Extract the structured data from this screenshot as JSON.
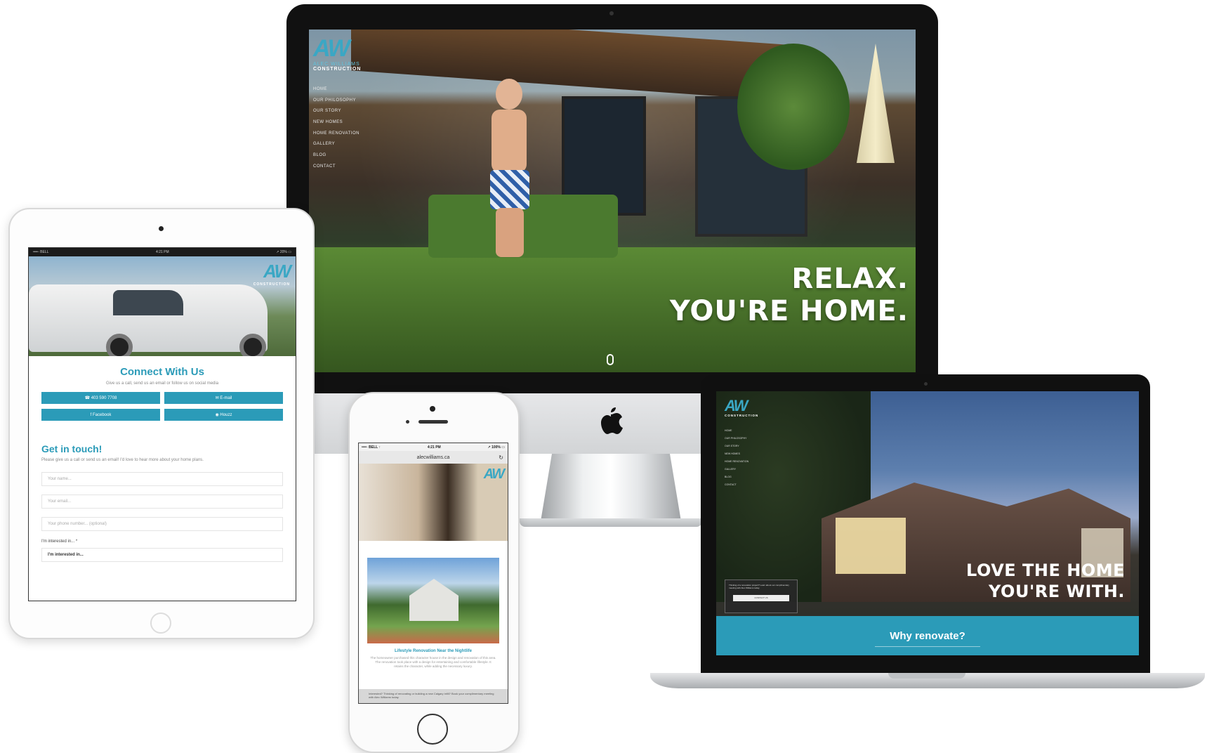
{
  "brand": {
    "logo_mark": "AW",
    "name_line1": "ALEC WILLIAMS",
    "name_line2": "CONSTRUCTION"
  },
  "desktop": {
    "nav": [
      "HOME",
      "OUR PHILOSOPHY",
      "OUR STORY",
      "NEW HOMES",
      "HOME RENOVATION",
      "GALLERY",
      "BLOG",
      "CONTACT"
    ],
    "headline_line1": "RELAX.",
    "headline_line2": "YOU'RE HOME."
  },
  "tablet": {
    "status_left": "••••◦ BELL",
    "status_center": "4:21 PM",
    "status_right": "↗ 20% ▭",
    "connect_title": "Connect With Us",
    "connect_subtitle": "Give us a call, send us an email or follow us on social media",
    "buttons": [
      "☎ 403 590 7708",
      "✉ E-mail",
      "f Facebook",
      "◉ Houzz"
    ],
    "touch_title": "Get in touch!",
    "touch_subtitle": "Please give us a call or send us an email! I'd love to hear more about your home plans.",
    "field_name": "Your name...",
    "field_email": "Your email...",
    "field_phone": "Your phone number... (optional)",
    "interest_label": "I'm interested in... *",
    "interest_value": "I'm interested in..."
  },
  "phone": {
    "status_left": "••••◦ BELL ↑",
    "status_center": "4:21 PM",
    "status_right": "↗ 100% ▭",
    "url": "alecwilliams.ca",
    "reload_icon": "↻",
    "card_title": "Lifestyle Renovation Near the Nightlife",
    "card_text": "The homeowner purchased this character house in the design and renovation of this area. The renovation took place with a design for entertaining and comfortable lifestyle. It retains the character, while adding the necessary luxury.",
    "footer_text": "Interested? Thinking of renovating or building a new Calgary infill? Book your complimentary meeting with Alec Williams today."
  },
  "laptop": {
    "nav": [
      "HOME",
      "OUR PHILOSOPHY",
      "OUR STORY",
      "NEW HOMES",
      "HOME RENOVATION",
      "GALLERY",
      "BLOG",
      "CONTACT"
    ],
    "popup_text": "Thinking of a renovation project? Learn about our complimentary meeting with Alec Williams today.",
    "popup_button": "CONTACT US",
    "headline_line1": "LOVE THE HOME",
    "headline_line2": "YOU'RE WITH.",
    "band_text": "Why renovate?"
  },
  "colors": {
    "brand_teal": "#2b9bb8"
  }
}
